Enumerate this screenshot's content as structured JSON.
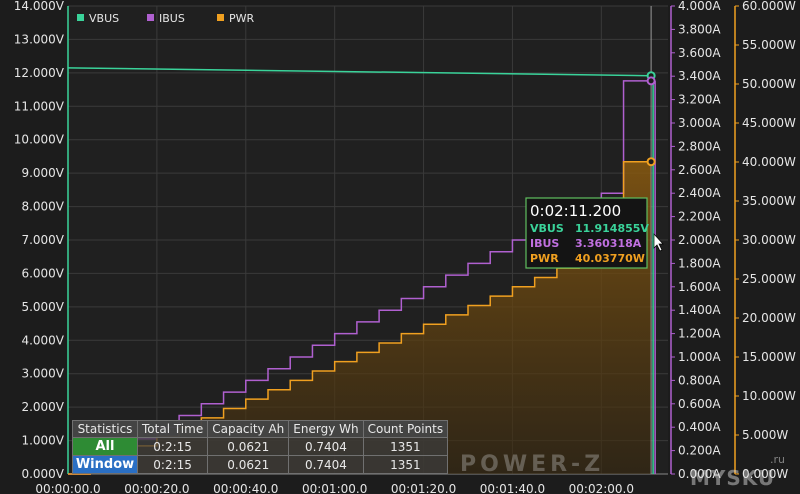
{
  "chart_data": {
    "type": "line",
    "x_ticks": [
      "00:00:00.0",
      "00:00:20.0",
      "00:00:40.0",
      "00:01:00.0",
      "00:01:20.0",
      "00:01:40.0",
      "00:02:00.0"
    ],
    "xlim": [
      0,
      135
    ],
    "axes": {
      "left": {
        "ticks": [
          "0.000V",
          "1.000V",
          "2.000V",
          "3.000V",
          "4.000V",
          "5.000V",
          "6.000V",
          "7.000V",
          "8.000V",
          "9.000V",
          "10.000V",
          "11.000V",
          "12.000V",
          "13.000V",
          "14.000V"
        ],
        "ylim": [
          0,
          14
        ]
      },
      "middle": {
        "ticks": [
          "0.000A",
          "0.200A",
          "0.400A",
          "0.600A",
          "0.800A",
          "1.000A",
          "1.200A",
          "1.400A",
          "1.600A",
          "1.800A",
          "2.000A",
          "2.200A",
          "2.400A",
          "2.600A",
          "2.800A",
          "3.000A",
          "3.200A",
          "3.400A",
          "3.600A",
          "3.800A",
          "4.000A"
        ],
        "ylim": [
          0,
          4
        ]
      },
      "right": {
        "ticks": [
          "0.000W",
          "5.000W",
          "10.000W",
          "15.000W",
          "20.000W",
          "25.000W",
          "30.000W",
          "35.000W",
          "40.000W",
          "45.000W",
          "50.000W",
          "55.000W",
          "60.000W"
        ],
        "ylim": [
          0,
          60
        ]
      }
    },
    "legend": [
      {
        "name": "VBUS",
        "color": "#3ad39a"
      },
      {
        "name": "IBUS",
        "color": "#b060d0"
      },
      {
        "name": "PWR",
        "color": "#f0a020"
      }
    ],
    "series": [
      {
        "name": "VBUS",
        "axis": "left",
        "x": [
          0,
          131.2
        ],
        "values": [
          12.15,
          11.915
        ]
      },
      {
        "name": "IBUS",
        "axis": "middle",
        "step": true,
        "x": [
          0,
          5,
          10,
          15,
          20,
          25,
          30,
          35,
          40,
          45,
          50,
          55,
          60,
          65,
          70,
          75,
          80,
          85,
          90,
          95,
          100,
          105,
          110,
          115,
          120,
          125,
          131.2
        ],
        "values": [
          0.0,
          0.1,
          0.2,
          0.3,
          0.4,
          0.5,
          0.6,
          0.7,
          0.8,
          0.9,
          1.0,
          1.1,
          1.2,
          1.3,
          1.4,
          1.5,
          1.6,
          1.7,
          1.8,
          1.9,
          2.0,
          2.1,
          2.2,
          2.3,
          2.4,
          3.36,
          3.36
        ]
      },
      {
        "name": "PWR",
        "axis": "right",
        "step": true,
        "fill": true,
        "x": [
          0,
          5,
          10,
          15,
          20,
          25,
          30,
          35,
          40,
          45,
          50,
          55,
          60,
          65,
          70,
          75,
          80,
          85,
          90,
          95,
          100,
          105,
          110,
          115,
          120,
          125,
          131.2
        ],
        "values": [
          0.0,
          1.2,
          2.4,
          3.6,
          4.8,
          6.0,
          7.2,
          8.4,
          9.6,
          10.8,
          12.0,
          13.2,
          14.4,
          15.6,
          16.8,
          18.0,
          19.2,
          20.4,
          21.6,
          22.8,
          24.0,
          25.2,
          26.4,
          27.6,
          28.8,
          40.04,
          40.04
        ]
      }
    ],
    "grid": true
  },
  "tooltip": {
    "time": "0:02:11.200",
    "rows": [
      {
        "label": "VBUS",
        "value": "11.914855V",
        "color": "#3ad39a"
      },
      {
        "label": "IBUS",
        "value": "3.360318A",
        "color": "#c070e0"
      },
      {
        "label": "PWR",
        "value": "40.03770W",
        "color": "#f0a020"
      }
    ]
  },
  "stats": {
    "headers": [
      "Statistics",
      "Total Time",
      "Capacity Ah",
      "Energy Wh",
      "Count Points"
    ],
    "rows": [
      {
        "label": "All",
        "cells": [
          "0:2:15",
          "0.0621",
          "0.7404",
          "1351"
        ]
      },
      {
        "label": "Window",
        "cells": [
          "0:2:15",
          "0.0621",
          "0.7404",
          "1351"
        ]
      }
    ]
  },
  "watermark": "POWER-Z",
  "site": "MYSKU",
  "site_suffix": ".ru"
}
